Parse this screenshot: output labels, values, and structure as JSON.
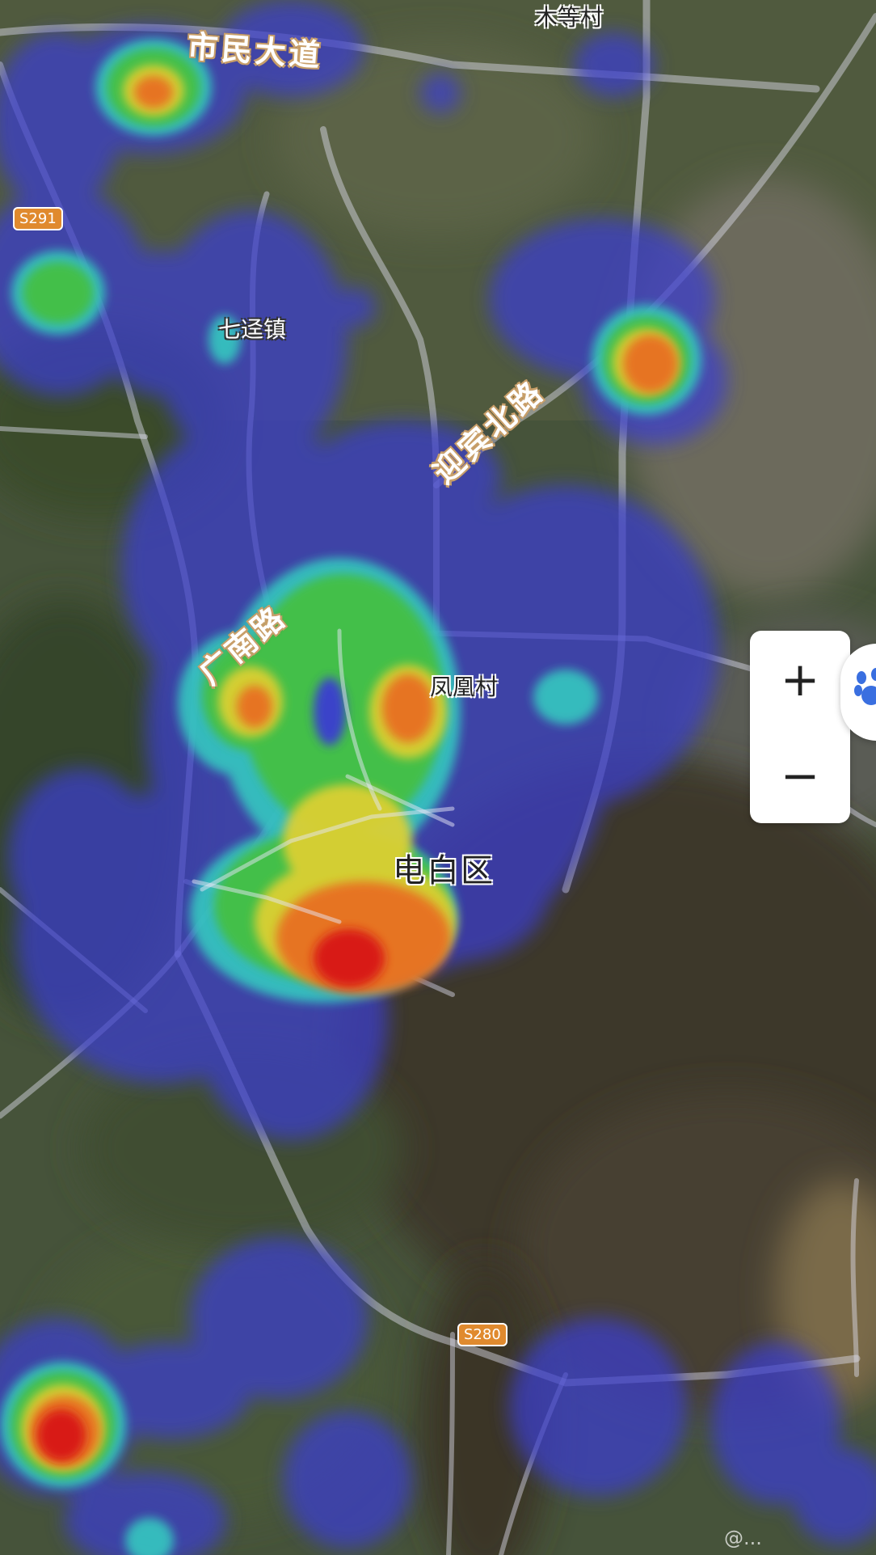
{
  "map": {
    "road_labels": [
      {
        "id": "shimin-avenue",
        "text": "市民大道"
      },
      {
        "id": "guangnan-road",
        "text": "广南路"
      },
      {
        "id": "yingbin-north-road",
        "text": "迎宾北路"
      }
    ],
    "place_labels": [
      {
        "id": "mudeng-village",
        "text": "木等村"
      },
      {
        "id": "qijing-town",
        "text": "七迳镇"
      },
      {
        "id": "fenghuang-village",
        "text": "凤凰村"
      }
    ],
    "district_label": "电白区",
    "route_shields": [
      {
        "id": "s291",
        "text": "S291"
      },
      {
        "id": "s280",
        "text": "S280"
      }
    ],
    "heatmap_colors": [
      "#3a3cd0",
      "#35c8c0",
      "#45c040",
      "#e0d030",
      "#e87020",
      "#d81818"
    ]
  },
  "controls": {
    "zoom_in_label": "+",
    "zoom_out_label": "−"
  },
  "watermark": "@..."
}
